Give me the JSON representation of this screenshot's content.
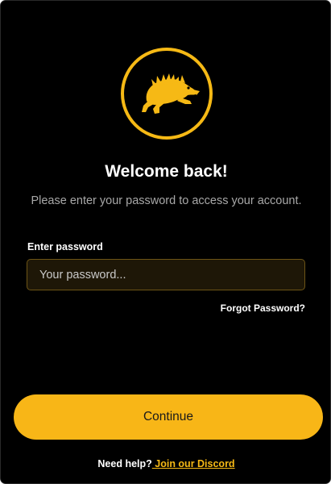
{
  "logo": {
    "icon": "boar-icon",
    "ring_color": "#f6b915"
  },
  "header": {
    "title": "Welcome back!",
    "subtitle": "Please enter your password to access your account."
  },
  "form": {
    "password_label": "Enter password",
    "password_placeholder": "Your password...",
    "password_value": "",
    "forgot_link": "Forgot Password?"
  },
  "actions": {
    "continue_label": "Continue"
  },
  "footer": {
    "help_text": "Need help?",
    "discord_link": " Join our Discord"
  },
  "colors": {
    "accent": "#f8b617",
    "background": "#000000",
    "input_background": "#1e1707",
    "input_border": "#6e5516",
    "subtitle": "#a8a8a8"
  }
}
